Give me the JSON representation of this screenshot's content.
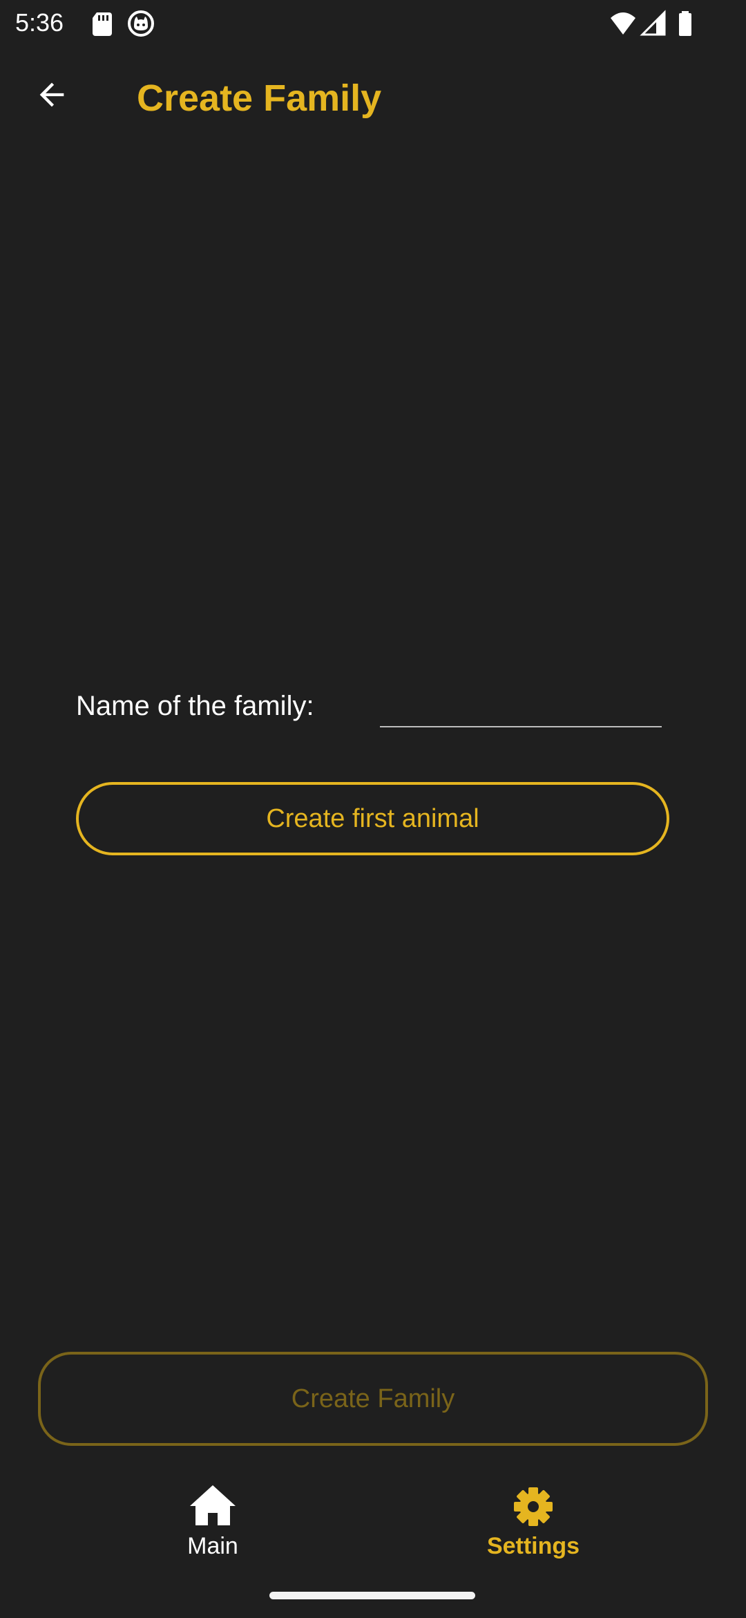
{
  "status_bar": {
    "time": "5:36",
    "icons": [
      "sd-card-icon",
      "cat-notification-icon",
      "wifi-icon",
      "cellular-signal-icon",
      "battery-icon"
    ]
  },
  "app_bar": {
    "title": "Create Family",
    "back_icon": "arrow-back-icon"
  },
  "form": {
    "name_label": "Name of the family:",
    "name_value": "",
    "first_animal_button": "Create first animal"
  },
  "create_family_button": "Create Family",
  "bottom_nav": {
    "items": [
      {
        "label": "Main",
        "icon": "home-icon",
        "selected": false
      },
      {
        "label": "Settings",
        "icon": "gear-icon",
        "selected": true
      }
    ]
  },
  "colors": {
    "background": "#1f1f1f",
    "accent": "#e5b520",
    "accent_disabled": "#7a6419",
    "text": "#ffffff"
  }
}
